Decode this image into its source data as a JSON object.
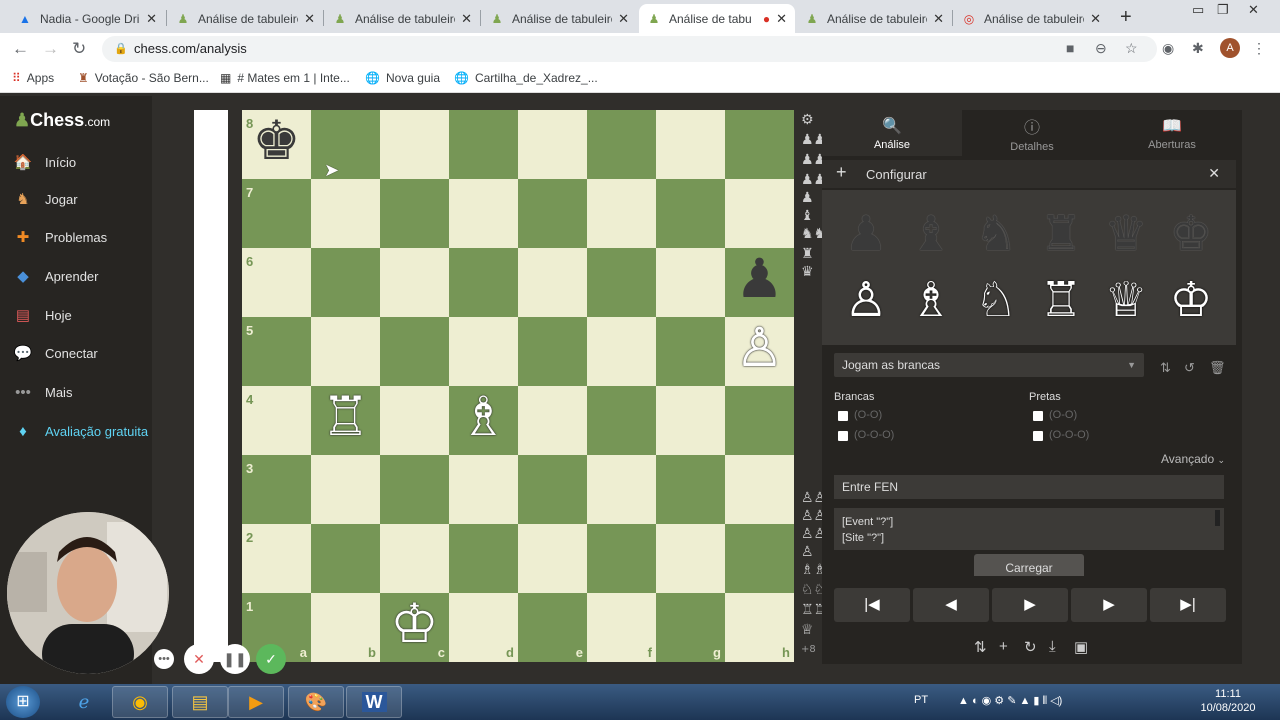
{
  "browser": {
    "tabs": [
      {
        "title": "Nadia - Google Dri",
        "icon": "google-drive-icon"
      },
      {
        "title": "Análise de tabuleiro",
        "icon": "chess-pawn-icon"
      },
      {
        "title": "Análise de tabuleiro",
        "icon": "chess-pawn-icon"
      },
      {
        "title": "Análise de tabuleiro",
        "icon": "chess-pawn-icon"
      },
      {
        "title": "Análise de tabu",
        "icon": "chess-pawn-icon"
      },
      {
        "title": "Análise de tabuleiro",
        "icon": "chess-pawn-icon"
      },
      {
        "title": "Análise de tabuleiro",
        "icon": "loading-icon"
      }
    ],
    "url": "chess.com/analysis",
    "avatar_letter": "A",
    "bookmarks": [
      "Apps",
      "Votação - São Bern...",
      "# Mates em 1 | Inte...",
      "Nova guia",
      "Cartilha_de_Xadrez_..."
    ]
  },
  "sidebar": {
    "logo": "Chess",
    "logo_suffix": ".com",
    "items": [
      {
        "label": "Início",
        "icon": "home-icon"
      },
      {
        "label": "Jogar",
        "icon": "play-icon"
      },
      {
        "label": "Problemas",
        "icon": "puzzle-icon"
      },
      {
        "label": "Aprender",
        "icon": "learn-icon"
      },
      {
        "label": "Hoje",
        "icon": "news-icon"
      },
      {
        "label": "Conectar",
        "icon": "chat-icon"
      },
      {
        "label": "Mais",
        "icon": "more-icon"
      },
      {
        "label": "Avaliação gratuita",
        "icon": "diamond-icon"
      }
    ]
  },
  "board": {
    "ranks": [
      "8",
      "7",
      "6",
      "5",
      "4",
      "3",
      "2",
      "1"
    ],
    "files": [
      "a",
      "b",
      "c",
      "d",
      "e",
      "f",
      "g",
      "h"
    ],
    "pieces": {
      "a8": {
        "glyph": "♚",
        "color": "b"
      },
      "h6": {
        "glyph": "♟",
        "color": "b"
      },
      "h5": {
        "glyph": "♙",
        "color": "w"
      },
      "b4": {
        "glyph": "♖",
        "color": "w"
      },
      "d4": {
        "glyph": "♗",
        "color": "w"
      },
      "c1": {
        "glyph": "♔",
        "color": "w"
      }
    },
    "captured_top_count": "",
    "captured_bottom_count": "+8"
  },
  "panel": {
    "tabs": [
      {
        "label": "Análise",
        "icon": "magnify-icon"
      },
      {
        "label": "Detalhes",
        "icon": "info-icon"
      },
      {
        "label": "Aberturas",
        "icon": "book-icon"
      }
    ],
    "config_label": "Configurar",
    "turn_select": "Jogam as brancas",
    "white_label": "Brancas",
    "black_label": "Pretas",
    "castle_short": "(O-O)",
    "castle_long": "(O-O-O)",
    "advanced": "Avançado",
    "fen_placeholder": "Entre FEN",
    "pgn_line1": "[Event \"?\"]",
    "pgn_line2": "[Site \"?\"]",
    "load_button": "Carregar"
  },
  "taskbar": {
    "lang": "PT",
    "time": "11:11",
    "date": "10/08/2020"
  },
  "colors": {
    "light_square": "#eeeed2",
    "dark_square": "#769656",
    "accent_diamond": "#5fd3f3",
    "confirm_green": "#5cb85c"
  }
}
